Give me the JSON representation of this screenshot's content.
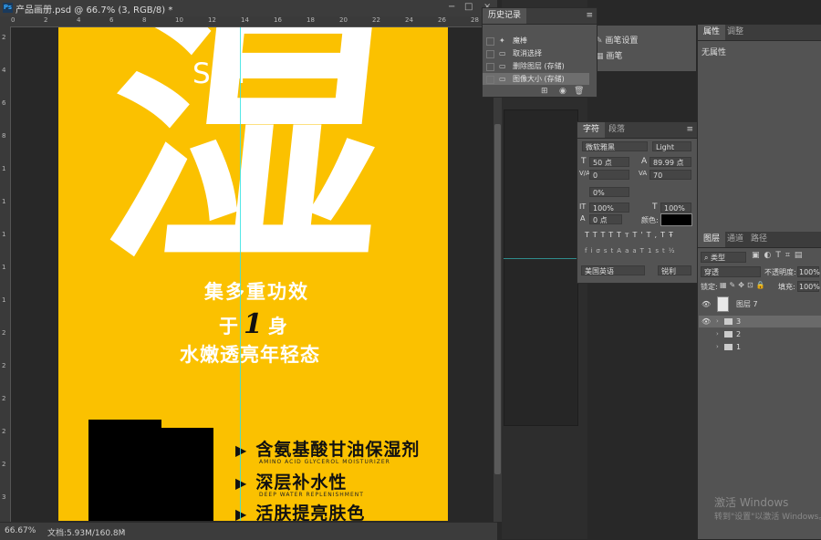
{
  "document": {
    "ps_logo": "Ps",
    "tab_title": "产品画册.psd @ 66.7% (3, RGB/8) *",
    "close": "×",
    "minimize": "−",
    "restore": "□"
  },
  "rulers": {
    "top": [
      "0",
      "2",
      "4",
      "6",
      "8",
      "10",
      "12",
      "14",
      "16",
      "18",
      "20",
      "22",
      "24",
      "26",
      "28"
    ],
    "left": [
      "2",
      "4",
      "6",
      "8",
      "1",
      "1",
      "1",
      "1",
      "1",
      "2",
      "2",
      "2",
      "2",
      "2",
      "3"
    ]
  },
  "canvas": {
    "big_character": "湿",
    "pinyin": "SHI",
    "slogan_line1": "集多重功效",
    "slogan_line2_pre": "于",
    "slogan_line2_num": "1",
    "slogan_line2_post": "身",
    "slogan_line3": "水嫩透亮年轻态",
    "features": [
      {
        "marker": "▶",
        "zh": "含氨基酸甘油保湿剂",
        "en": "AMINO ACID GLYCEROL MOISTURIZER"
      },
      {
        "marker": "▶",
        "zh": "深层补水性",
        "en": "DEEP WATER REPLENISHMENT"
      },
      {
        "marker": "▶",
        "zh": "活肤提亮肤色",
        "en": ""
      }
    ],
    "background_color": "#fbc100"
  },
  "status": {
    "zoom": "66.67%",
    "doc_size": "文档:5.93M/160.8M",
    "arrow": "›"
  },
  "history_panel": {
    "tab": "历史记录",
    "items": [
      {
        "icon": "wand-icon",
        "glyph": "✦",
        "label": "魔棒",
        "selected": false
      },
      {
        "icon": "step-icon",
        "glyph": "▭",
        "label": "取消选择",
        "selected": false
      },
      {
        "icon": "step-icon",
        "glyph": "▭",
        "label": "删除图层 (存储)",
        "selected": false
      },
      {
        "icon": "step-icon",
        "glyph": "▭",
        "label": "图像大小 (存储)",
        "selected": true
      }
    ],
    "footer_icons": [
      "⊞",
      "◉",
      "🗑"
    ]
  },
  "brush_panel": {
    "items": [
      "画笔设置",
      "画笔"
    ]
  },
  "character_panel": {
    "tabs": [
      "字符",
      "段落"
    ],
    "font_family": "微软雅黑",
    "font_style": "Light",
    "font_size": "50 点",
    "leading": "89.99 点",
    "kerning": "0",
    "tracking": "70",
    "scale_pct": "0%",
    "vertical_scale": "100%",
    "horizontal_scale": "100%",
    "baseline_shift": "0 点",
    "color_label": "颜色:",
    "style_buttons": [
      "T",
      "T",
      "TT",
      "Tт",
      "T'",
      "T,",
      "T",
      "Ŧ"
    ],
    "opentype_buttons": [
      "fi",
      "σ",
      "st",
      "A",
      "aa",
      "T",
      "1st",
      "½"
    ],
    "language": "美国英语",
    "antialias": "锐利",
    "labels": {
      "size": "T",
      "leading": "A",
      "kern": "V/A",
      "track": "VA",
      "scale": "IT",
      "hscale": "T",
      "shift": "A"
    }
  },
  "properties_panel": {
    "tabs": [
      "属性",
      "调整"
    ],
    "empty": "无属性"
  },
  "layers_panel": {
    "tabs": [
      "图层",
      "通道",
      "路径"
    ],
    "filter_kind": "类型",
    "blend_mode": "穿透",
    "opacity_label": "不透明度:",
    "opacity": "100%",
    "lock_label": "锁定:",
    "fill_label": "填充:",
    "fill": "100%",
    "layers": [
      {
        "name": "图层 7",
        "type": "pixel",
        "visible": true,
        "selected": false
      },
      {
        "name": "3",
        "type": "group",
        "visible": true,
        "selected": true
      },
      {
        "name": "2",
        "type": "group",
        "visible": false,
        "selected": false
      },
      {
        "name": "1",
        "type": "group",
        "visible": false,
        "selected": false
      }
    ]
  },
  "windows_watermark": {
    "line1": "激活 Windows",
    "line2": "转到\"设置\"以激活 Windows。"
  }
}
